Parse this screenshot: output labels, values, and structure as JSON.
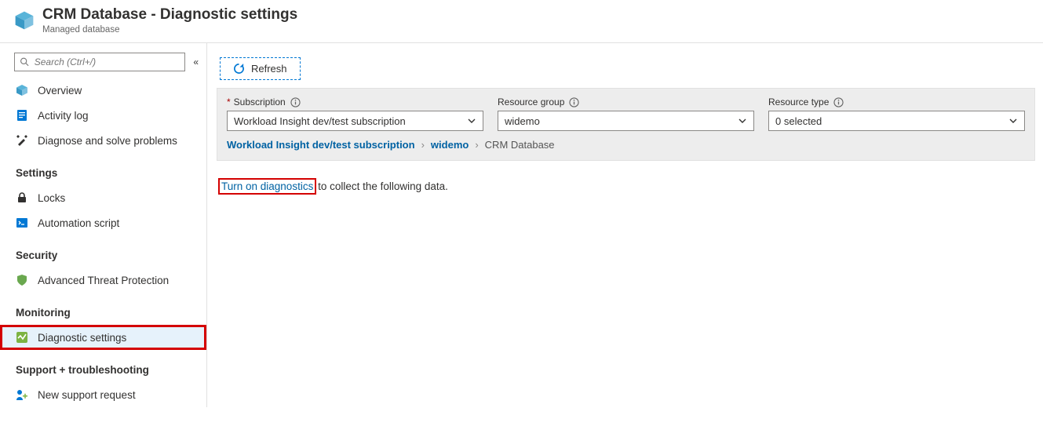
{
  "header": {
    "title": "CRM Database - Diagnostic settings",
    "subtitle": "Managed database"
  },
  "sidebar": {
    "search_placeholder": "Search (Ctrl+/)",
    "items_top": [
      {
        "label": "Overview",
        "icon": "cube"
      },
      {
        "label": "Activity log",
        "icon": "log"
      },
      {
        "label": "Diagnose and solve problems",
        "icon": "tools"
      }
    ],
    "sections": {
      "settings": {
        "label": "Settings",
        "items": [
          {
            "label": "Locks",
            "icon": "lock"
          },
          {
            "label": "Automation script",
            "icon": "script"
          }
        ]
      },
      "security": {
        "label": "Security",
        "items": [
          {
            "label": "Advanced Threat Protection",
            "icon": "shield"
          }
        ]
      },
      "monitoring": {
        "label": "Monitoring",
        "items": [
          {
            "label": "Diagnostic settings",
            "icon": "diag",
            "selected": true,
            "red_box": true
          }
        ]
      },
      "support": {
        "label": "Support + troubleshooting",
        "items": [
          {
            "label": "New support request",
            "icon": "support"
          }
        ]
      }
    }
  },
  "toolbar": {
    "refresh": "Refresh"
  },
  "filters": {
    "subscription": {
      "label": "Subscription",
      "value": "Workload Insight dev/test subscription",
      "required": true
    },
    "resource_group": {
      "label": "Resource group",
      "value": "widemo"
    },
    "resource_type": {
      "label": "Resource type",
      "value": "0 selected"
    }
  },
  "breadcrumb": {
    "a": "Workload Insight dev/test subscription",
    "b": "widemo",
    "c": "CRM Database"
  },
  "message": {
    "link": "Turn on diagnostics",
    "rest": " to collect the following data."
  }
}
